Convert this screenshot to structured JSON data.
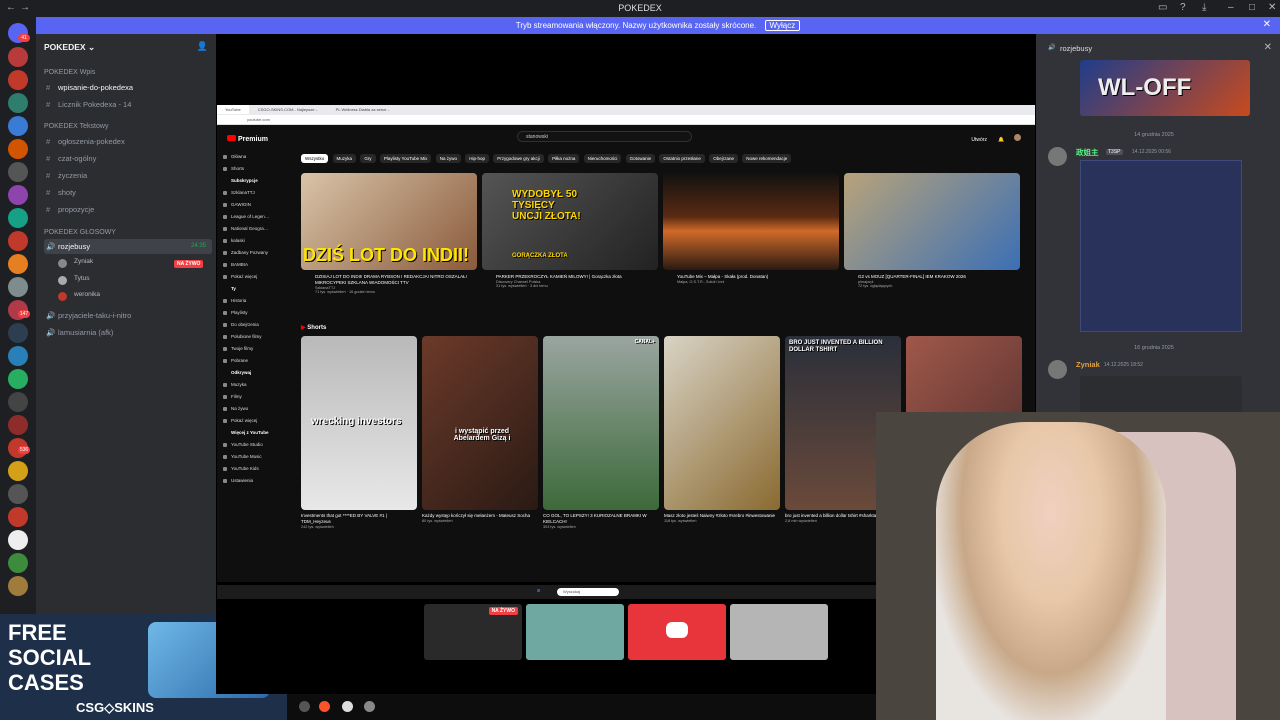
{
  "window": {
    "title": "POKEDEX"
  },
  "banner": {
    "text": "Tryb streamowania włączony. Nazwy użytkownika zostały skrócone.",
    "button": "Wyłącz"
  },
  "server_badges": [
    "41",
    "147",
    "536"
  ],
  "sidebar": {
    "server_name": "POKEDEX",
    "categories": [
      {
        "label": "POKEDEX Wpis",
        "channels": [
          {
            "name": "wpisanie-do-pokedexa",
            "bold": true
          },
          {
            "name": "Licznik Pokedexa - 14",
            "bold": false
          }
        ]
      },
      {
        "label": "POKEDEX Tekstowy",
        "channels": [
          {
            "name": "ogłoszenia-pokedex"
          },
          {
            "name": "czat-ogólny"
          },
          {
            "name": "życzenia"
          },
          {
            "name": "shoty"
          },
          {
            "name": "propozycje"
          }
        ]
      }
    ],
    "voice_category": "POKEDEX GŁOSOWY",
    "voice_channel": {
      "name": "rozjebusy",
      "time": "24:35"
    },
    "voice_users": [
      {
        "name": "Zyniak",
        "live": "NA ŻYWO"
      },
      {
        "name": "Tytus"
      },
      {
        "name": "weronika"
      }
    ],
    "other_voice": [
      "przyjaciele-taku-i-nitro",
      "lamusiarnia (afk)"
    ]
  },
  "promo": {
    "line1": "FREE",
    "line2": "SOCIAL",
    "line3": "CASES",
    "brand": "CSG◇SKINS"
  },
  "youtube": {
    "tabs": [
      "YouTube",
      "CSGO-SKINS.COM - Najlepsze…",
      "PL Wellness Diabła za serce…"
    ],
    "url": "youtube.com",
    "logo": "Premium",
    "search": "stanowski",
    "create": "Utwórz",
    "nav_main": [
      "Główna",
      "Shorts"
    ],
    "subs_label": "Subskrypcje",
    "subs": [
      "SzklanaTTJ",
      "GAWIGIN",
      "League of Legen…",
      "National Geogra…",
      "kalaski",
      "Zadbany Pozwany",
      "BAMBIA",
      "Pokaż więcej"
    ],
    "you_label": "Ty",
    "you": [
      "Historia",
      "Playlisty",
      "Do obejrzenia",
      "Polubione filmy",
      "Twoje filmy",
      "Pobrane"
    ],
    "explore_label": "Odkrywaj",
    "explore": [
      "Muzyka",
      "Filmy",
      "Na żywo",
      "Pokaż więcej"
    ],
    "more_label": "Więcej z YouTube",
    "more": [
      "YouTube Studio",
      "YouTube Music",
      "YouTube Kids"
    ],
    "settings": "Ustawienia",
    "chips": [
      "Wszystko",
      "Muzyka",
      "Gry",
      "Playlisty YouTube Mix",
      "Na żywo",
      "Hip-hop",
      "Przygodowe gry akcji",
      "Piłka nożna",
      "Nieruchomości",
      "Gotowanie",
      "Ostatnio przesłane",
      "Obejrzane",
      "Nowe rekomendacje"
    ],
    "videos": [
      {
        "title": "DZISIAJ LOT DO INDII! DRAMA RYBSON I REDAKCJA! NITRO OSZALAŁ! MIKROCYPEKI SZKLANA WIADOMOŚCI TTV",
        "channel": "SzklanaTTJ",
        "meta": "71 tys. wyświetleń · 16 godzin temu",
        "overlay": "DZIŚ LOT DO INDII!"
      },
      {
        "title": "PARKER PRZEKROCZYŁ KAMIEŃ MILOWY! | Gorączka złota",
        "channel": "Discovery Channel Polska",
        "meta": "31 tys. wyświetleń · 3 dni temu",
        "overlay": "WYDOBYŁ 50 TYSIĘCY UNCJI ZŁOTA!",
        "badge": "GORĄCZKA ZŁOTA"
      },
      {
        "title": "YouTube Mix – Małpa - Skała (prod. Donatan)",
        "channel": "Małpa, O.S.T.R., Sokół i inni",
        "meta": ""
      },
      {
        "title": "G2 vs MOUZ [QUARTER-FINAL] IEM KRAKOW 2026",
        "channel": "plmajorpl",
        "meta": "72 tys. oglądających"
      }
    ],
    "shorts_label": "Shorts",
    "shorts": [
      {
        "title": "Investments that got ****ED BY VALVE #1 | TDM_Heyzeus",
        "meta": "242 tys. wyświetleń",
        "overlay": "wrecking investors"
      },
      {
        "title": "Każdy występ kończył się melanżem - Mateusz Socha",
        "meta": "80 tys. wyświetleń",
        "overlay": "i wystąpić przed Abelardem Gizą i"
      },
      {
        "title": "CO GOL, TO LEPSZY! 3 KURIOZALNE BRAMKI W KIELCACH!",
        "meta": "303 tys. wyświetleń",
        "badge": "CANAL+"
      },
      {
        "title": "Masz złoto jesteś Naiwny #złoto #srebro #inwestowanie",
        "meta": "118 tys. wyświetleń"
      },
      {
        "title": "bro just invented a billion dollar tshirt #sharktank",
        "meta": "2,8 mln wyświetleń",
        "overlay": "BRO JUST INVENTED A BILLION DOLLAR TSHIRT"
      },
      {
        "title": "",
        "meta": ""
      }
    ],
    "taskbar_search": "Wyszukaj"
  },
  "stream_tiles": [
    {
      "live": "NA ŻYWO"
    },
    {},
    {},
    {}
  ],
  "chat": {
    "header": "rozjebusy",
    "banner_text": "WL-OFF",
    "date1": "14 grudnia 2025",
    "msg1": {
      "author": "政姐主",
      "tag": "T3SP",
      "time": "14.12.2025 00:56"
    },
    "date2": "16 grudnia 2025",
    "msg2": {
      "author": "Zyniak",
      "time": "14.12.2025 18:52"
    }
  },
  "colors": {
    "discord_blurple": "#5865f2",
    "yt_red": "#ff0000",
    "live_red": "#f23f43"
  }
}
